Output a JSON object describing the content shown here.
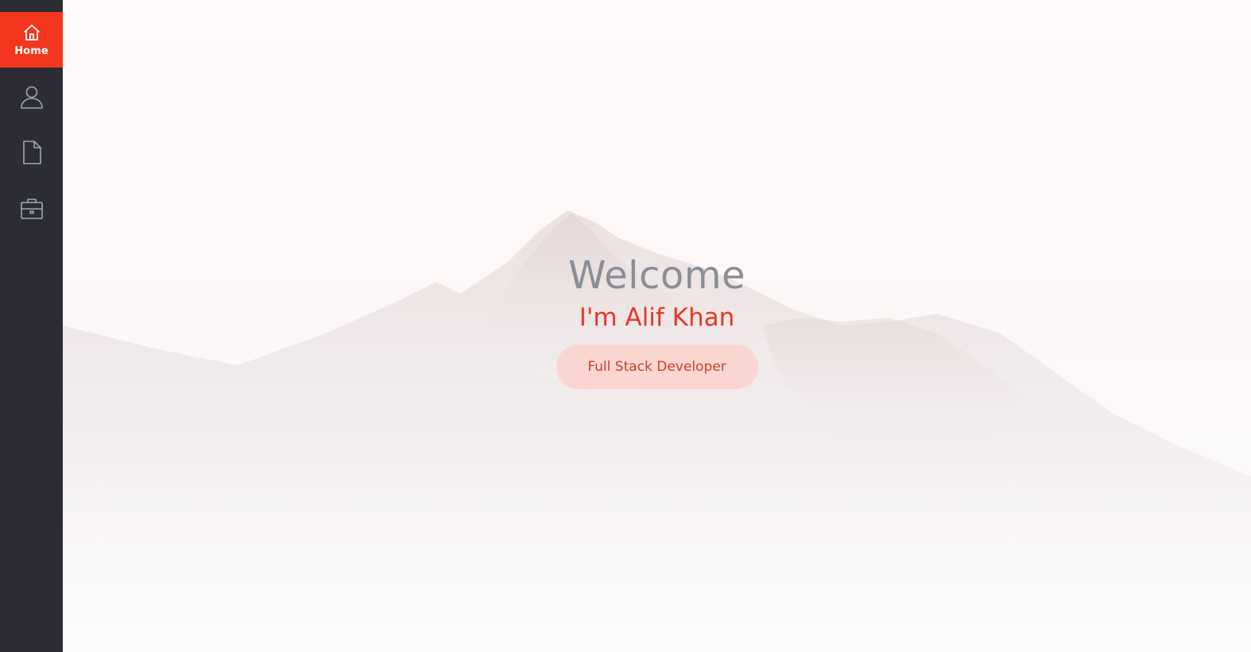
{
  "sidebar": {
    "items": [
      {
        "label": "Home",
        "icon": "home-icon",
        "active": true
      },
      {
        "label": "",
        "icon": "user-icon",
        "active": false
      },
      {
        "label": "",
        "icon": "document-icon",
        "active": false
      },
      {
        "label": "",
        "icon": "briefcase-icon",
        "active": false
      }
    ],
    "colors": {
      "background": "#2b2c34",
      "active": "#f3361e",
      "icon": "#a5a7ad"
    }
  },
  "hero": {
    "title": "Welcome",
    "name": "I'm Alif Khan",
    "role": "Full Stack Developer",
    "colors": {
      "title": "#8a8e96",
      "name": "#e23a27",
      "role_bg": "#fcd2cb",
      "role_text": "#c8402e"
    }
  }
}
